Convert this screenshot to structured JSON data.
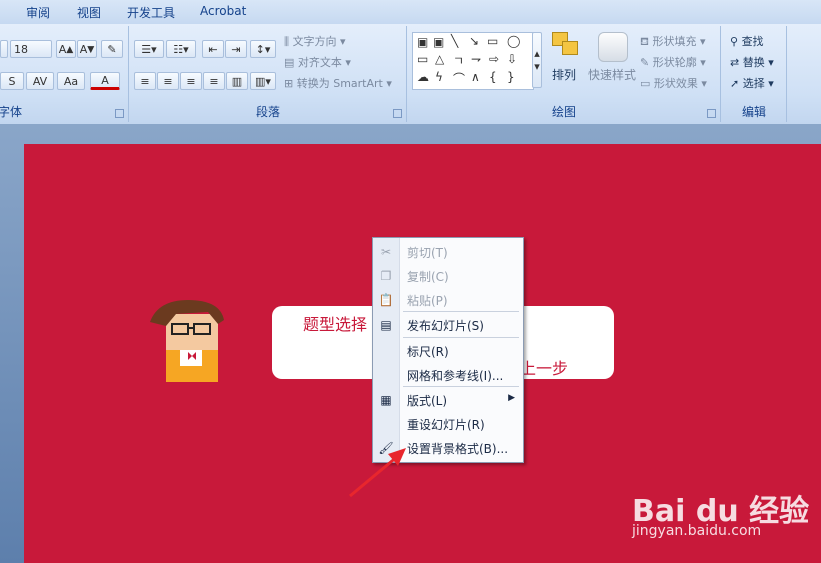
{
  "tabs": [
    "审阅",
    "视图",
    "开发工具",
    "Acrobat"
  ],
  "ribbon": {
    "font": {
      "label": "字体",
      "size_value": "18",
      "grow_icon": "A-grow-icon",
      "shrink_icon": "A-shrink-icon",
      "spacing_label": "AV",
      "case_label": "Aa",
      "color_label": "A",
      "strike_label": "S"
    },
    "paragraph": {
      "label": "段落",
      "text_direction": "文字方向",
      "align_text": "对齐文本",
      "convert_smartart": "转换为 SmartArt"
    },
    "drawing": {
      "label": "绘图",
      "arrange": "排列",
      "quick_styles": "快速样式",
      "shape_fill": "形状填充",
      "shape_outline": "形状轮廓",
      "shape_effects": "形状效果"
    },
    "editing": {
      "label": "编辑",
      "find": "查找",
      "replace": "替换",
      "select": "选择"
    }
  },
  "slide": {
    "banner_title": "题型选择",
    "banner_sub": "上一步",
    "bg_color": "#c8193a"
  },
  "context_menu": {
    "items": [
      {
        "label": "剪切(T)",
        "icon": "scissors-icon",
        "enabled": false
      },
      {
        "label": "复制(C)",
        "icon": "copy-icon",
        "enabled": false
      },
      {
        "label": "粘贴(P)",
        "icon": "paste-icon",
        "enabled": false
      },
      {
        "label": "发布幻灯片(S)",
        "icon": "publish-slides-icon",
        "enabled": true
      },
      {
        "label": "标尺(R)",
        "icon": "",
        "enabled": true
      },
      {
        "label": "网格和参考线(I)...",
        "icon": "",
        "enabled": true
      },
      {
        "label": "版式(L)",
        "icon": "layout-icon",
        "enabled": true,
        "submenu": true
      },
      {
        "label": "重设幻灯片(R)",
        "icon": "",
        "enabled": true
      },
      {
        "label": "设置背景格式(B)...",
        "icon": "format-background-icon",
        "enabled": true
      }
    ]
  },
  "watermark": {
    "logo": "Bai du 经验",
    "url": "jingyan.baidu.com"
  }
}
